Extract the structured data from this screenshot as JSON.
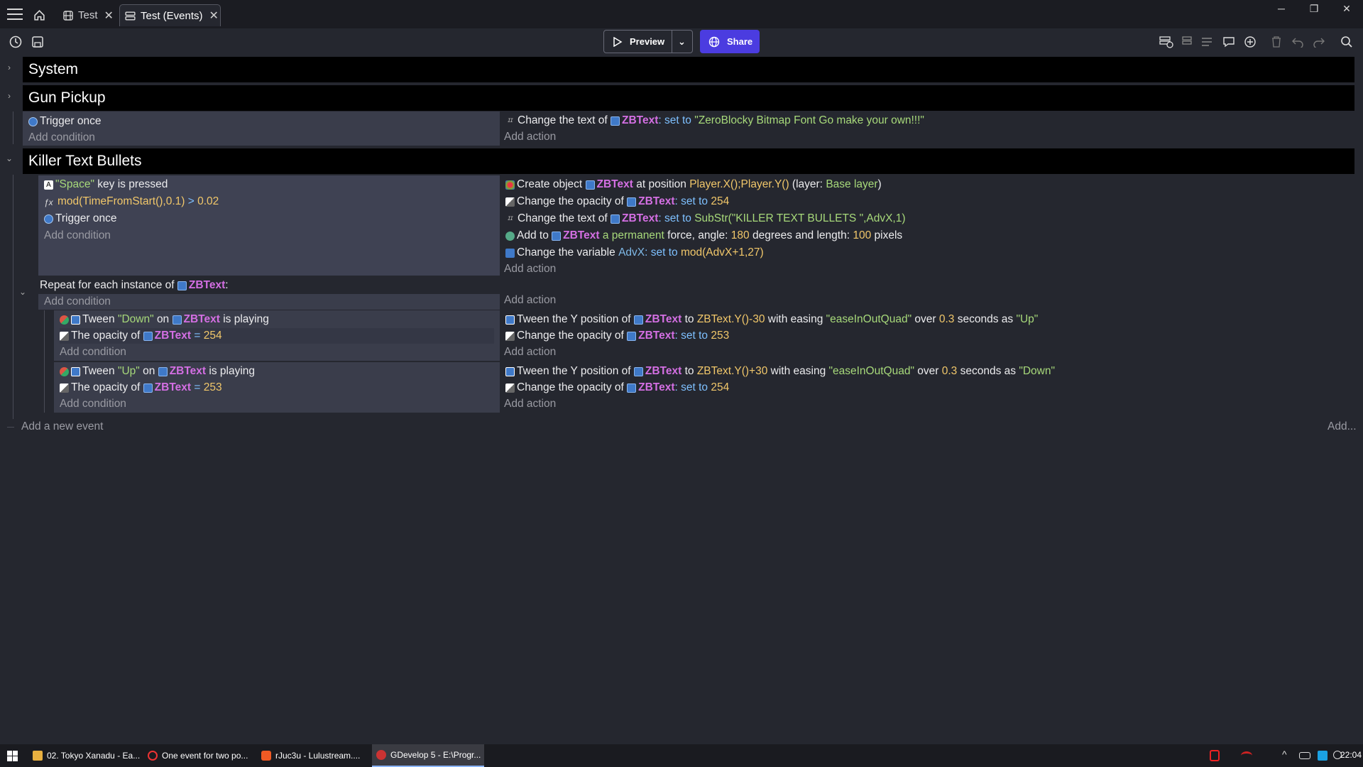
{
  "tabs": [
    {
      "label": "Test"
    },
    {
      "label": "Test (Events)"
    }
  ],
  "toolbar": {
    "preview": "Preview",
    "share": "Share"
  },
  "groups": {
    "system": "System",
    "gun": "Gun Pickup",
    "killer": "Killer Text Bullets"
  },
  "gun": {
    "cond1": "Trigger once",
    "add_condition": "Add condition",
    "act1_pre": "Change the text of",
    "act1_obj": "ZBText",
    "act1_set": ": set to",
    "act1_val": "\"ZeroBlocky Bitmap Font Go make your own!!!\"",
    "add_action": "Add action"
  },
  "killer": {
    "c1_key": "\"Space\"",
    "c1_rest": "key is pressed",
    "c2_expr": "mod(TimeFromStart(),0.1)",
    "c2_op": ">",
    "c2_val": "0.02",
    "c3": "Trigger once",
    "add_condition": "Add condition",
    "a1_pre": "Create object",
    "a1_obj": "ZBText",
    "a1_mid": "at position",
    "a1_pos": "Player.X();Player.Y()",
    "a1_layer_pre": "(layer:",
    "a1_layer": "Base layer",
    "a1_layer_post": ")",
    "a2_pre": "Change the opacity of",
    "a2_obj": "ZBText",
    "a2_set": ": set to",
    "a2_val": "254",
    "a3_pre": "Change the text of",
    "a3_obj": "ZBText",
    "a3_set": ": set to",
    "a3_val": "SubStr(\"KILLER TEXT BULLETS \",AdvX,1)",
    "a4_pre": "Add to",
    "a4_obj": "ZBText",
    "a4_kind": "a permanent",
    "a4_force": "force, angle:",
    "a4_angle": "180",
    "a4_deg": "degrees and length:",
    "a4_len": "100",
    "a4_px": "pixels",
    "a5_pre": "Change the variable",
    "a5_var": "AdvX",
    "a5_set": ": set to",
    "a5_val": "mod(AdvX+1,27)",
    "add_action": "Add action"
  },
  "repeat": {
    "label": "Repeat for each instance of",
    "obj": "ZBText",
    "colon": ":",
    "add_condition": "Add condition",
    "add_action": "Add action",
    "sub1": {
      "c1_pre": "Tween",
      "c1_name": "\"Down\"",
      "c1_on": "on",
      "c1_obj": "ZBText",
      "c1_post": "is playing",
      "c2_pre": "The opacity of",
      "c2_obj": "ZBText",
      "c2_op": "=",
      "c2_val": "254",
      "a1_pre": "Tween the Y position of",
      "a1_obj": "ZBText",
      "a1_to": "to",
      "a1_val": "ZBText.Y()-30",
      "a1_with": "with easing",
      "a1_ease": "\"easeInOutQuad\"",
      "a1_over": "over",
      "a1_dur": "0.3",
      "a1_sec": "seconds as",
      "a1_as": "\"Up\"",
      "a2_pre": "Change the opacity of",
      "a2_obj": "ZBText",
      "a2_set": ": set to",
      "a2_val": "253"
    },
    "sub2": {
      "c1_pre": "Tween",
      "c1_name": "\"Up\"",
      "c1_on": "on",
      "c1_obj": "ZBText",
      "c1_post": "is playing",
      "c2_pre": "The opacity of",
      "c2_obj": "ZBText",
      "c2_op": "=",
      "c2_val": "253",
      "a1_pre": "Tween the Y position of",
      "a1_obj": "ZBText",
      "a1_to": "to",
      "a1_val": "ZBText.Y()+30",
      "a1_with": "with easing",
      "a1_ease": "\"easeInOutQuad\"",
      "a1_over": "over",
      "a1_dur": "0.3",
      "a1_sec": "seconds as",
      "a1_as": "\"Down\"",
      "a2_pre": "Change the opacity of",
      "a2_obj": "ZBText",
      "a2_set": ": set to",
      "a2_val": "254"
    }
  },
  "footer": {
    "add_event": "Add a new event",
    "add": "Add..."
  },
  "taskbar": [
    {
      "label": "02. Tokyo Xanadu - Ea..."
    },
    {
      "label": "One event for two po..."
    },
    {
      "label": "rJuc3u - Lulustream...."
    },
    {
      "label": "GDevelop 5 - E:\\Progr..."
    }
  ],
  "clock": "22:04",
  "colors": {
    "object": "#d46fe3",
    "string": "#a7d97a",
    "number": "#f1c76a",
    "variable": "#7fb9e8",
    "accent": "#4b3ce0"
  }
}
